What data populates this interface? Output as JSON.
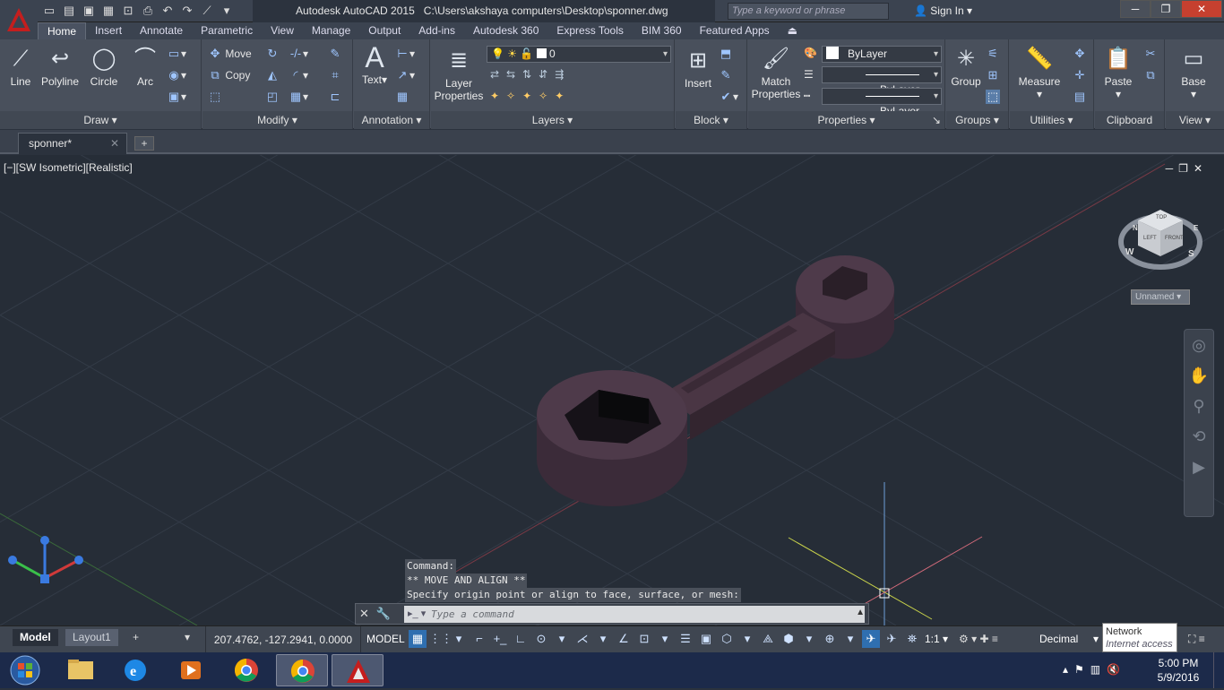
{
  "title_bar": {
    "title": "Autodesk AutoCAD 2015",
    "path": "C:\\Users\\akshaya computers\\Desktop\\sponner.dwg",
    "search_placeholder": "Type a keyword or phrase",
    "sign_in": "Sign In"
  },
  "ribbon_tabs": [
    "Home",
    "Insert",
    "Annotate",
    "Parametric",
    "View",
    "Manage",
    "Output",
    "Add-ins",
    "Autodesk 360",
    "Express Tools",
    "BIM 360",
    "Featured Apps"
  ],
  "panels": {
    "draw": {
      "title": "Draw",
      "line": "Line",
      "polyline": "Polyline",
      "circle": "Circle",
      "arc": "Arc"
    },
    "modify": {
      "title": "Modify",
      "move": "Move",
      "copy": "Copy"
    },
    "annotation": {
      "title": "Annotation",
      "text": "Text"
    },
    "layers": {
      "title": "Layers",
      "layer_properties_1": "Layer",
      "layer_properties_2": "Properties",
      "current_layer": "0"
    },
    "block": {
      "title": "Block",
      "insert": "Insert"
    },
    "properties": {
      "title": "Properties",
      "match_1": "Match",
      "match_2": "Properties",
      "color": "ByLayer",
      "linetype": "ByLayer",
      "lineweight": "ByLayer"
    },
    "groups": {
      "title": "Groups",
      "group": "Group"
    },
    "utilities": {
      "title": "Utilities",
      "measure": "Measure"
    },
    "clipboard": {
      "title": "Clipboard",
      "paste": "Paste"
    },
    "view": {
      "title": "View",
      "base": "Base"
    }
  },
  "file_tab": "sponner*",
  "viewport": {
    "label": "[−][SW Isometric][Realistic]",
    "viewcube": {
      "top": "TOP",
      "left": "LEFT",
      "front": "FRONT",
      "n": "N",
      "w": "W",
      "s": "S",
      "e": "E"
    },
    "ucs_name": "Unnamed"
  },
  "command": {
    "history": [
      "Command:",
      "** MOVE AND ALIGN **",
      "Specify origin point or align to face, surface, or mesh:"
    ],
    "placeholder": "Type a command"
  },
  "status": {
    "model_tab": "Model",
    "layout_tab": "Layout1",
    "coords": "207.4762, -127.2941, 0.0000",
    "space": "MODEL",
    "scale": "1:1",
    "units": "Decimal"
  },
  "notification": {
    "title": "Network",
    "subtitle": "Internet access"
  },
  "clock": {
    "time": "5:00 PM",
    "date": "5/9/2016"
  },
  "colors": {
    "accent": "#2f6fb0",
    "object": "#4a3644",
    "viewport_bg": "#262d37"
  }
}
